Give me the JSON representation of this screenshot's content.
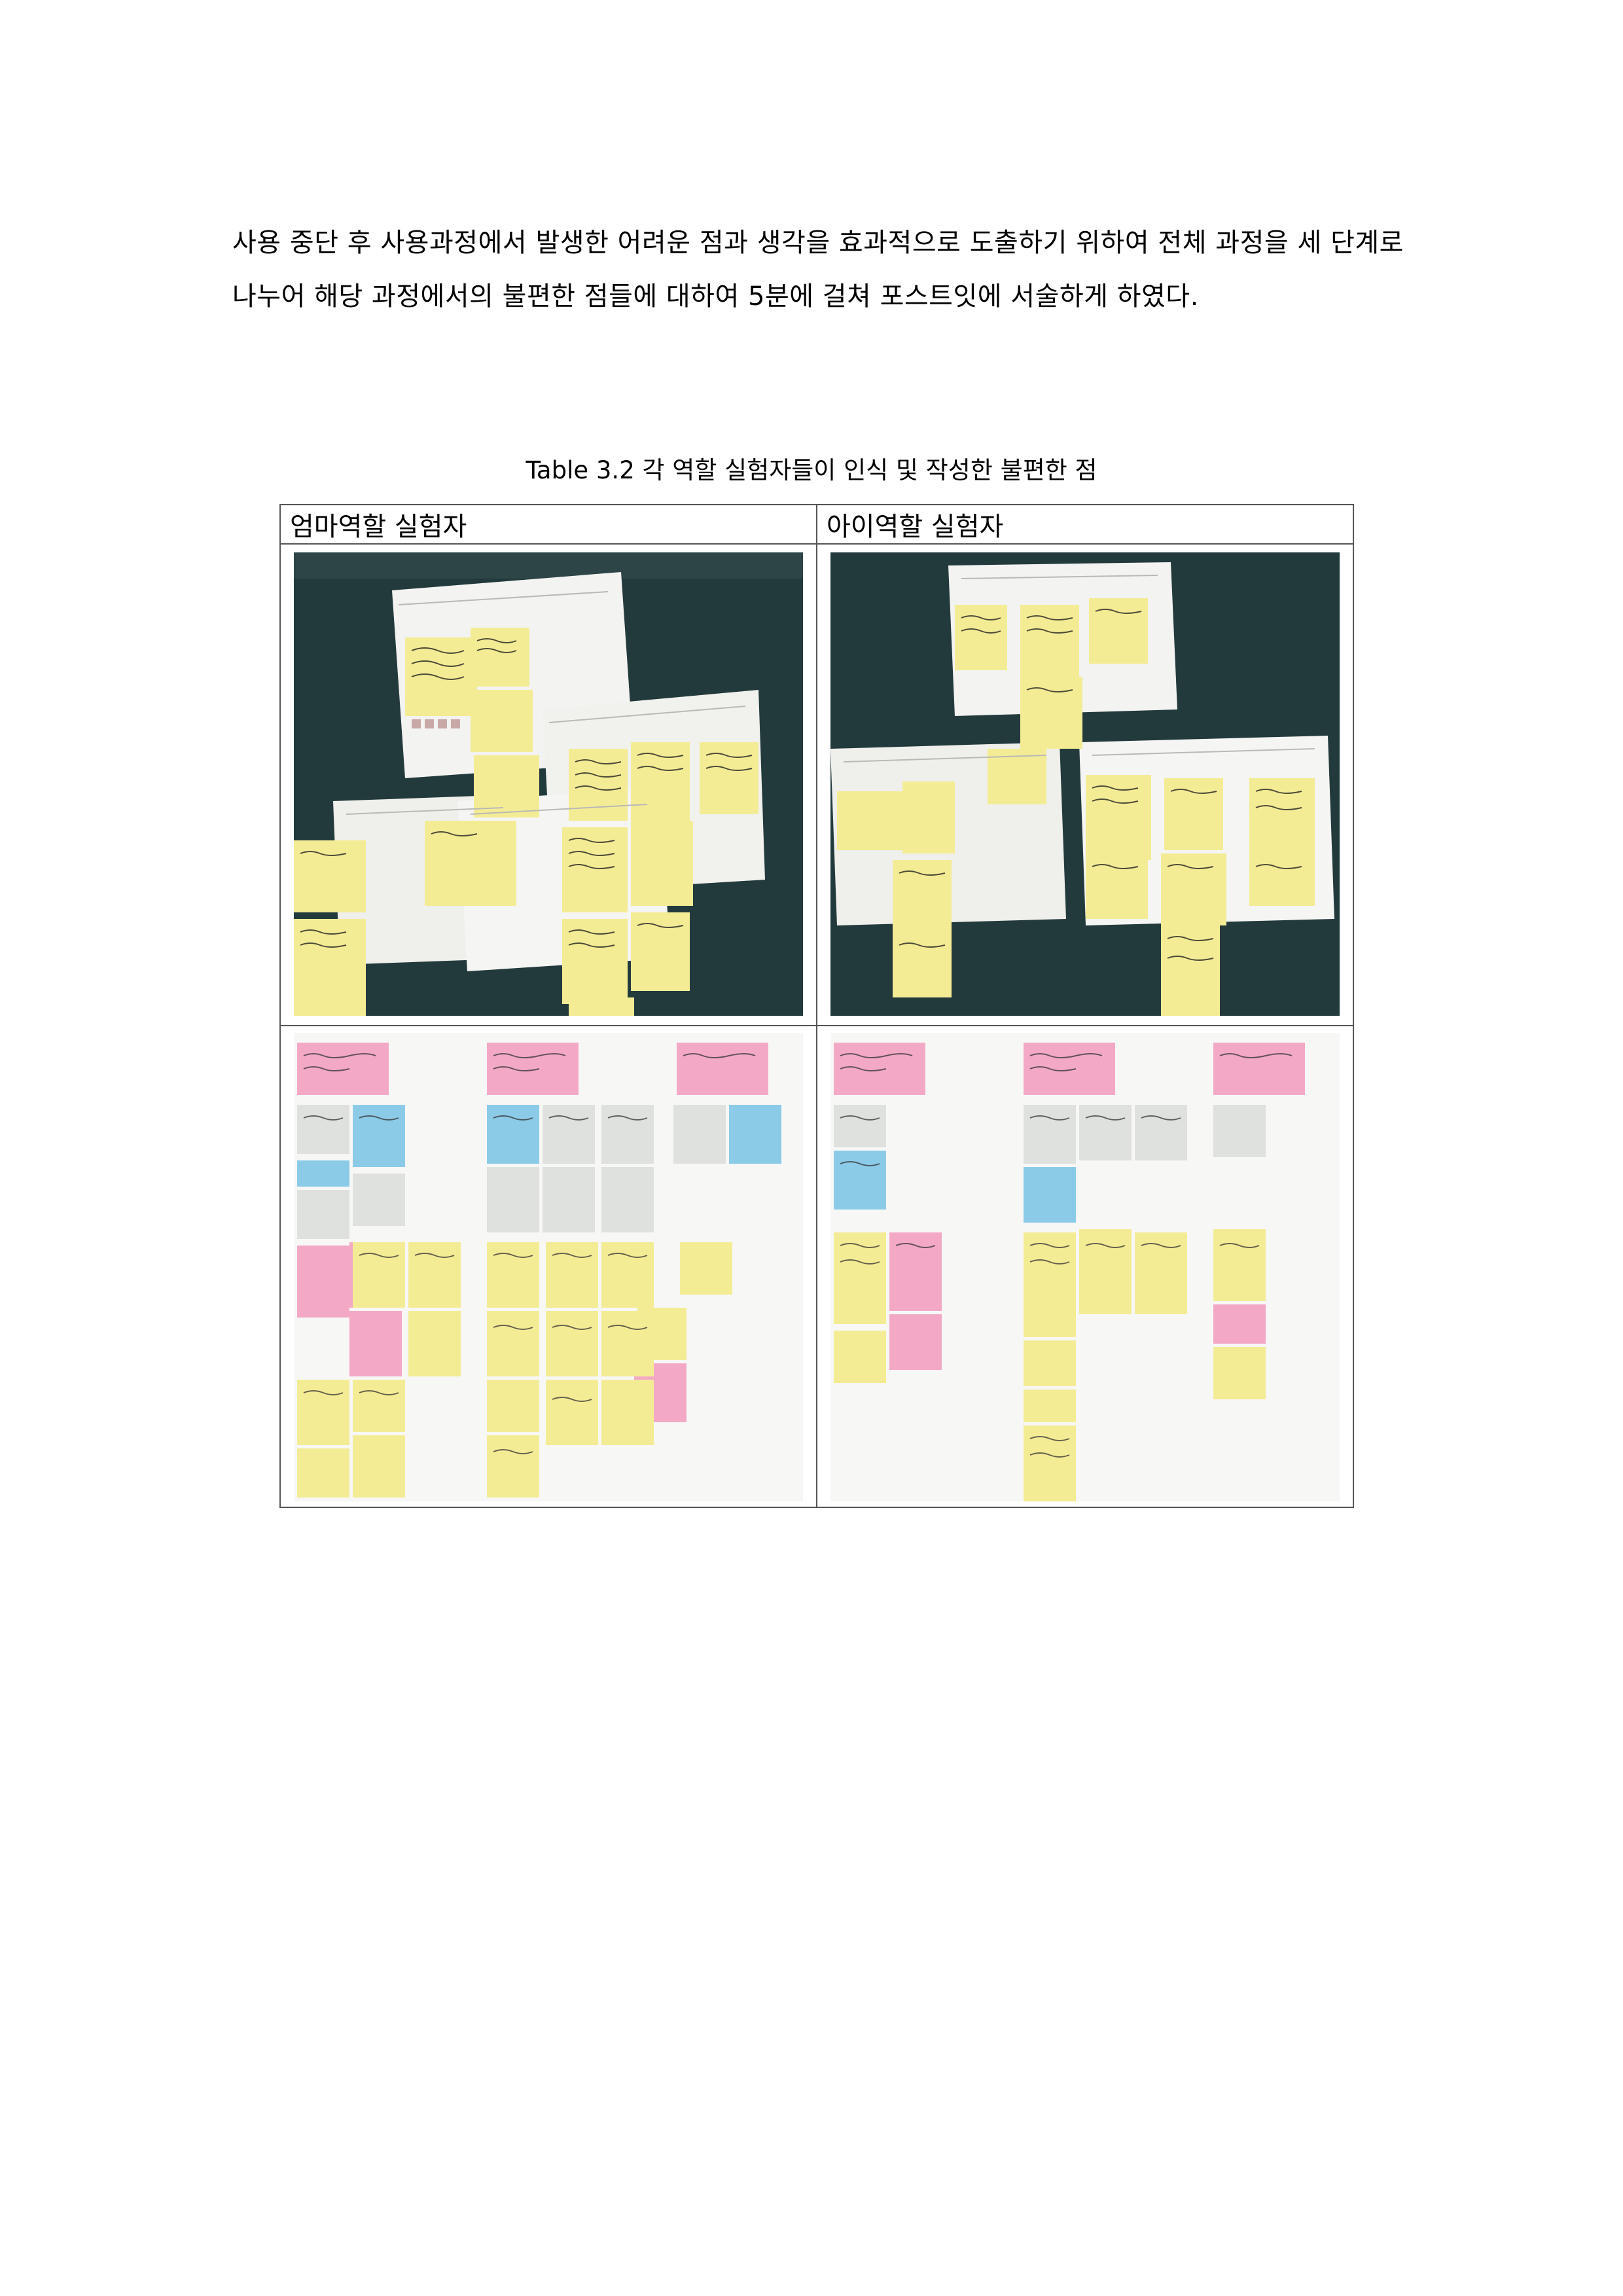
{
  "body_text": "사용 중단 후 사용과정에서 발생한 어려운 점과 생각을 효과적으로 도출하기 위하여 전체 과정을 세 단계로 나누어 해당 과정에서의 불편한 점들에 대하여 5분에 걸쳐 포스트잇에 서술하게 하였다.",
  "caption": "Table 3.2 각 역할 실험자들이 인식 및 작성한 불편한 점",
  "table": {
    "headers": [
      "엄마역할 실험자",
      "아이역할 실험자"
    ]
  },
  "colors": {
    "table_dark": "#233a3c",
    "sticky_yellow": "#f4ec95",
    "sticky_pink": "#f3a9c6",
    "sticky_blue": "#8ccbe8",
    "sticky_gray": "#dfe1df",
    "paper": "#f3f3f1"
  }
}
